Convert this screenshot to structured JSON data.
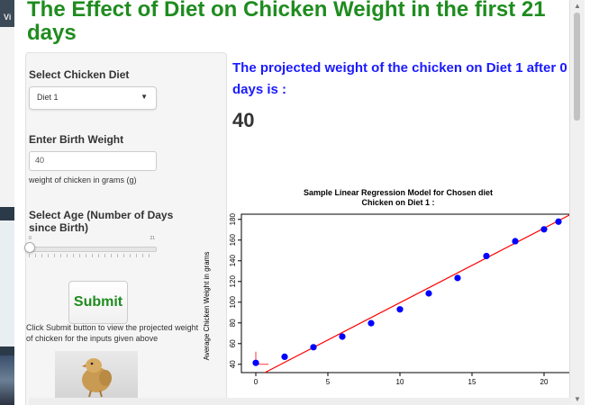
{
  "background": {
    "window_title": "Vi"
  },
  "page": {
    "title": "The Effect of Diet on Chicken Weight in the first 21 days"
  },
  "sidebar": {
    "diet_label": "Select Chicken Diet",
    "diet_value": "Diet 1",
    "birth_weight_label": "Enter Birth Weight",
    "birth_weight_value": "40",
    "birth_weight_help": "weight of chicken in grams (g)",
    "age_label": "Select Age (Number of Days since Birth)",
    "age_slider": {
      "min": 0,
      "max": 21,
      "value": 0,
      "min_label": "0",
      "max_label": "21"
    },
    "submit_label": "Submit",
    "submit_help": "Click Submit button to view the projected weight of chicken for the inputs given above"
  },
  "main": {
    "projection_text": "The projected weight of the chicken on Diet 1 after 0 days is :",
    "projected_weight": "40"
  },
  "colors": {
    "title_green": "#1f8c1f",
    "projection_blue": "#1a1aff",
    "point_blue": "#0000ff",
    "fit_line_red": "#ff0000"
  },
  "chart_data": {
    "type": "scatter",
    "title": "Sample Linear Regression Model for Chosen diet",
    "subtitle": "Chicken on Diet 1 :",
    "xlabel": "",
    "ylabel": "Average Chicken Weight in grams",
    "xlim": [
      -1,
      22
    ],
    "ylim": [
      32,
      185
    ],
    "x_ticks": [
      0,
      5,
      10,
      15,
      20
    ],
    "y_ticks": [
      40,
      60,
      80,
      100,
      120,
      140,
      160,
      180
    ],
    "grid": false,
    "points": {
      "x": [
        0,
        2,
        4,
        6,
        8,
        10,
        12,
        14,
        16,
        18,
        20,
        21
      ],
      "y": [
        41.4,
        47.3,
        56.5,
        66.8,
        79.7,
        93.1,
        108.5,
        123.4,
        144.6,
        158.9,
        170.4,
        177.8
      ]
    },
    "fit_line": {
      "intercept": 27.5,
      "slope": 7.2
    },
    "highlight": {
      "x": 0,
      "y": 40
    }
  }
}
